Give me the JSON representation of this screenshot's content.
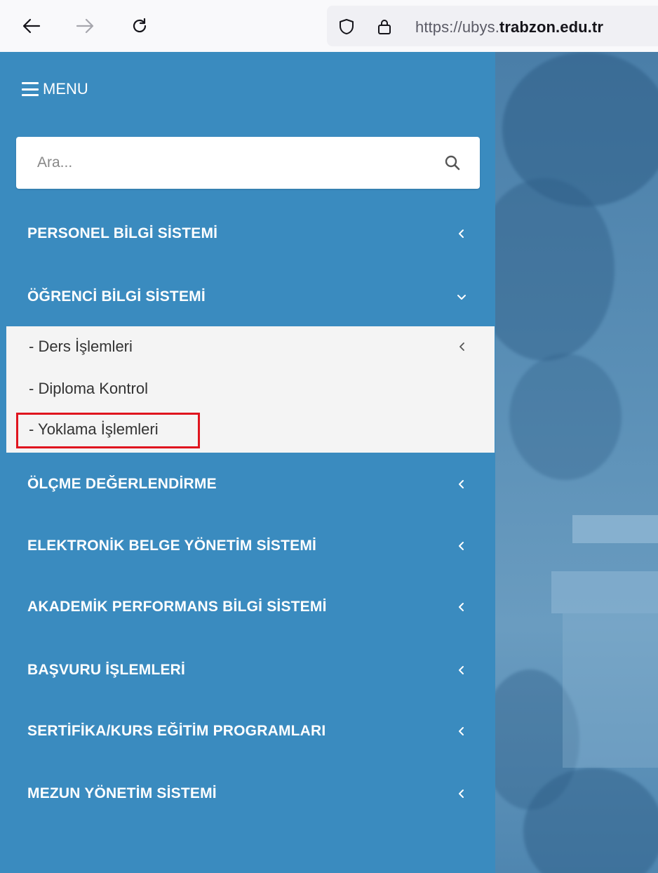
{
  "browser": {
    "url_prefix": "https://ubys.",
    "url_domain": "trabzon.edu.tr"
  },
  "sidebar": {
    "menu_label": "MENU",
    "search_placeholder": "Ara...",
    "items": [
      {
        "label": "PERSONEL BİLGİ SİSTEMİ"
      },
      {
        "label": "ÖĞRENCİ BİLGİ SİSTEMİ",
        "expanded": true,
        "children": [
          {
            "label": "- Ders İşlemleri"
          },
          {
            "label": "- Diploma Kontrol"
          },
          {
            "label": "- Yoklama İşlemleri",
            "highlighted": true
          }
        ]
      },
      {
        "label": "ÖLÇME DEĞERLENDİRME"
      },
      {
        "label": "ELEKTRONİK BELGE YÖNETİM SİSTEMİ"
      },
      {
        "label": "AKADEMİK PERFORMANS BİLGİ SİSTEMİ"
      },
      {
        "label": "BAŞVURU İŞLEMLERİ"
      },
      {
        "label": "SERTİFİKA/KURS EĞİTİM PROGRAMLARI"
      },
      {
        "label": "MEZUN YÖNETİM SİSTEMİ"
      }
    ]
  },
  "colors": {
    "sidebar_bg": "#3a8bbf",
    "submenu_bg": "#f4f4f4",
    "highlight_border": "#e0151f"
  },
  "icons": {
    "back": "arrow-left-icon",
    "forward": "arrow-right-icon",
    "reload": "reload-icon",
    "shield": "shield-icon",
    "lock": "lock-icon",
    "hamburger": "hamburger-icon",
    "search": "search-icon",
    "chevron_left": "chevron-left-icon",
    "chevron_down": "chevron-down-icon"
  }
}
